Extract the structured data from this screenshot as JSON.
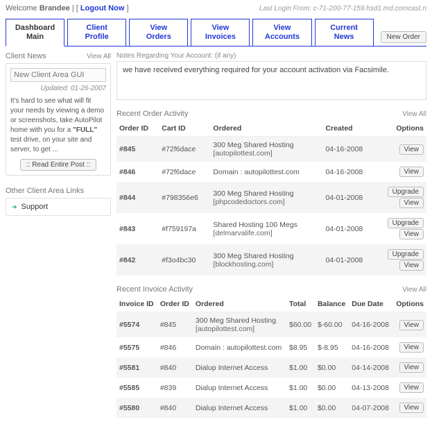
{
  "header": {
    "welcome_prefix": "Welcome",
    "user_name": "Brandee",
    "separator": " | [ ",
    "logout_label": "Logout Now",
    "separator_close": " ]",
    "last_login": "Last Login From: c-71-200-77-159.hsd1.md.comcast.n"
  },
  "tabs": [
    {
      "line1": "Dashboard",
      "line2": "Main",
      "active": true
    },
    {
      "line1": "Client",
      "line2": "Profile"
    },
    {
      "line1": "View",
      "line2": "Orders"
    },
    {
      "line1": "View",
      "line2": "Invoices"
    },
    {
      "line1": "View",
      "line2": "Accounts"
    },
    {
      "line1": "Current",
      "line2": "News"
    }
  ],
  "new_order_label": "New Order",
  "sidebar": {
    "news_head": "Client News",
    "news_viewall": "View All",
    "news_input_value": "New Client Area GUI",
    "updated_label": "Updated: 01-26-2007",
    "news_body_prefix": "It's hard to see what will fit your needs by viewing a demo or screenshots, take AutoPilot home with you for a ",
    "news_body_bold": "\"FULL\"",
    "news_body_suffix": " test drive, on your site and server, to get ...",
    "read_post_label": ":: Read Entire Post ::",
    "links_head": "Other Client Area Links",
    "links": [
      {
        "label": "Support"
      }
    ]
  },
  "notes": {
    "head": "Notes Regarding Your Account: (if any)",
    "body": "we have received everything required for your account activation via Facsimile."
  },
  "orders": {
    "head": "Recent Order Activity",
    "viewall": "View All",
    "cols": {
      "order_id": "Order ID",
      "cart_id": "Cart ID",
      "ordered": "Ordered",
      "created": "Created",
      "options": "Options"
    },
    "rows": [
      {
        "order_id": "#845",
        "cart_id": "#72f6dace",
        "ordered_main": "300 Meg Shared Hosting",
        "ordered_sub": "[autopilottest.com]",
        "created": "04-16-2008",
        "opts": [
          "View"
        ]
      },
      {
        "order_id": "#846",
        "cart_id": "#72f6dace",
        "ordered_main": "Domain : autopilottest.com",
        "ordered_sub": "",
        "created": "04-16-2008",
        "opts": [
          "View"
        ]
      },
      {
        "order_id": "#844",
        "cart_id": "#798356e6",
        "ordered_main": "300 Meg Shared Hosting",
        "ordered_sub": "[phpcodedoctors.com]",
        "created": "04-01-2008",
        "opts": [
          "Upgrade",
          "View"
        ]
      },
      {
        "order_id": "#843",
        "cart_id": "#f759197a",
        "ordered_main": "Shared Hosting 100 Megs",
        "ordered_sub": "[delmarvalife.com]",
        "created": "04-01-2008",
        "opts": [
          "Upgrade",
          "View"
        ]
      },
      {
        "order_id": "#842",
        "cart_id": "#f3o4bc30",
        "ordered_main": "300 Meg Shared Hosting",
        "ordered_sub": "[blockhosting.com]",
        "created": "04-01-2008",
        "opts": [
          "Upgrade",
          "View"
        ]
      }
    ]
  },
  "invoices": {
    "head": "Recent Invoice Activity",
    "viewall": "View All",
    "cols": {
      "invoice_id": "Invoice ID",
      "order_id": "Order ID",
      "ordered": "Ordered",
      "total": "Total",
      "balance": "Balance",
      "due": "Due Date",
      "options": "Options"
    },
    "rows": [
      {
        "invoice_id": "#5574",
        "order_id": "#845",
        "ordered_main": "300 Meg Shared Hosting",
        "ordered_sub": "[autopilottest.com]",
        "total": "$60.00",
        "balance": "$-60.00",
        "bal_class": "neg",
        "due": "04-16-2008",
        "opts": [
          "View"
        ]
      },
      {
        "invoice_id": "#5575",
        "order_id": "#846",
        "ordered_main": "Domain : autopilottest.com",
        "ordered_sub": "",
        "total": "$8.95",
        "balance": "$-8.95",
        "bal_class": "neg",
        "due": "04-16-2008",
        "opts": [
          "View"
        ]
      },
      {
        "invoice_id": "#5581",
        "order_id": "#840",
        "ordered_main": "Dialup Internet Access",
        "ordered_sub": "",
        "total": "$1.00",
        "balance": "$0.00",
        "bal_class": "pos",
        "due": "04-14-2008",
        "opts": [
          "View"
        ]
      },
      {
        "invoice_id": "#5585",
        "order_id": "#839",
        "ordered_main": "Dialup Internet Access",
        "ordered_sub": "",
        "total": "$1.00",
        "balance": "$0.00",
        "bal_class": "pos",
        "due": "04-13-2008",
        "opts": [
          "View"
        ]
      },
      {
        "invoice_id": "#5580",
        "order_id": "#840",
        "ordered_main": "Dialup Internet Access",
        "ordered_sub": "",
        "total": "$1.00",
        "balance": "$0.00",
        "bal_class": "pos",
        "due": "04-07-2008",
        "opts": [
          "View"
        ]
      }
    ]
  }
}
